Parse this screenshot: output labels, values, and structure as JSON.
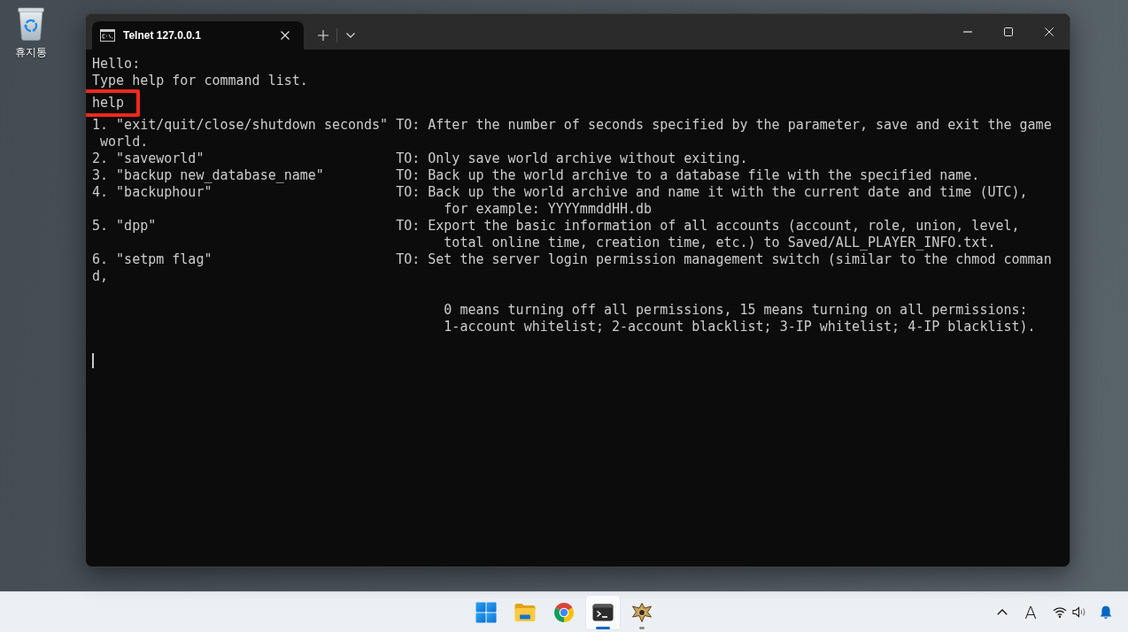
{
  "desktop": {
    "icons": [
      {
        "label": "휴지통"
      }
    ]
  },
  "window": {
    "tabs": [
      {
        "title": "Telnet 127.0.0.1",
        "selected": true
      }
    ]
  },
  "terminal": {
    "lines": [
      {
        "kind": "output",
        "text": "Hello:",
        "highlighted": false
      },
      {
        "kind": "output",
        "text": "Type help for command list.",
        "highlighted": false
      },
      {
        "kind": "output",
        "text": "help",
        "highlighted": true
      },
      {
        "kind": "entry",
        "command": "1. \"exit/quit/close/shutdown seconds\"",
        "description": "TO: After the number of seconds specified by the parameter, save and exit the game",
        "highlighted": false
      },
      {
        "kind": "output",
        "text": " world.",
        "highlighted": false
      },
      {
        "kind": "entry",
        "command": "2. \"saveworld\"",
        "description": "TO: Only save world archive without exiting.",
        "highlighted": false
      },
      {
        "kind": "entry",
        "command": "3. \"backup new_database_name\"",
        "description": "TO: Back up the world archive to a database file with the specified name.",
        "highlighted": false
      },
      {
        "kind": "entry",
        "command": "4. \"backuphour\"",
        "description": "TO: Back up the world archive and name it with the current date and time (UTC),",
        "highlighted": false
      },
      {
        "kind": "continuation",
        "text": "for example: YYYYmmddHH.db",
        "highlighted": false
      },
      {
        "kind": "entry",
        "command": "5. \"dpp\"",
        "description": "TO: Export the basic information of all accounts (account, role, union, level,",
        "highlighted": false
      },
      {
        "kind": "continuation",
        "text": "total online time, creation time, etc.) to Saved/ALL_PLAYER_INFO.txt.",
        "highlighted": false
      },
      {
        "kind": "entry",
        "command": "6. \"setpm flag\"",
        "description": "TO: Set the server login permission management switch (similar to the chmod comman",
        "highlighted": false
      },
      {
        "kind": "output",
        "text": "d,",
        "highlighted": false
      },
      {
        "kind": "blank",
        "highlighted": false
      },
      {
        "kind": "continuation",
        "text": "0 means turning off all permissions, 15 means turning on all permissions:",
        "highlighted": false
      },
      {
        "kind": "continuation",
        "text": "1-account whitelist; 2-account blacklist; 3-IP whitelist; 4-IP blacklist).",
        "highlighted": false
      },
      {
        "kind": "blank",
        "highlighted": false
      },
      {
        "kind": "cursor",
        "highlighted": false
      }
    ]
  },
  "taskbar": {
    "apps": [
      {
        "kind": "start",
        "active": false,
        "running": false
      },
      {
        "kind": "folder",
        "active": false,
        "running": false
      },
      {
        "kind": "browser",
        "active": false,
        "running": false
      },
      {
        "kind": "terminal",
        "active": true,
        "running": true
      },
      {
        "kind": "emblem",
        "active": false,
        "running": true
      }
    ],
    "tray": [
      {
        "kind": "chevron"
      },
      {
        "kind": "ime",
        "label": "A"
      },
      {
        "kind": "wifi"
      },
      {
        "kind": "speaker"
      },
      {
        "kind": "bell"
      }
    ]
  }
}
